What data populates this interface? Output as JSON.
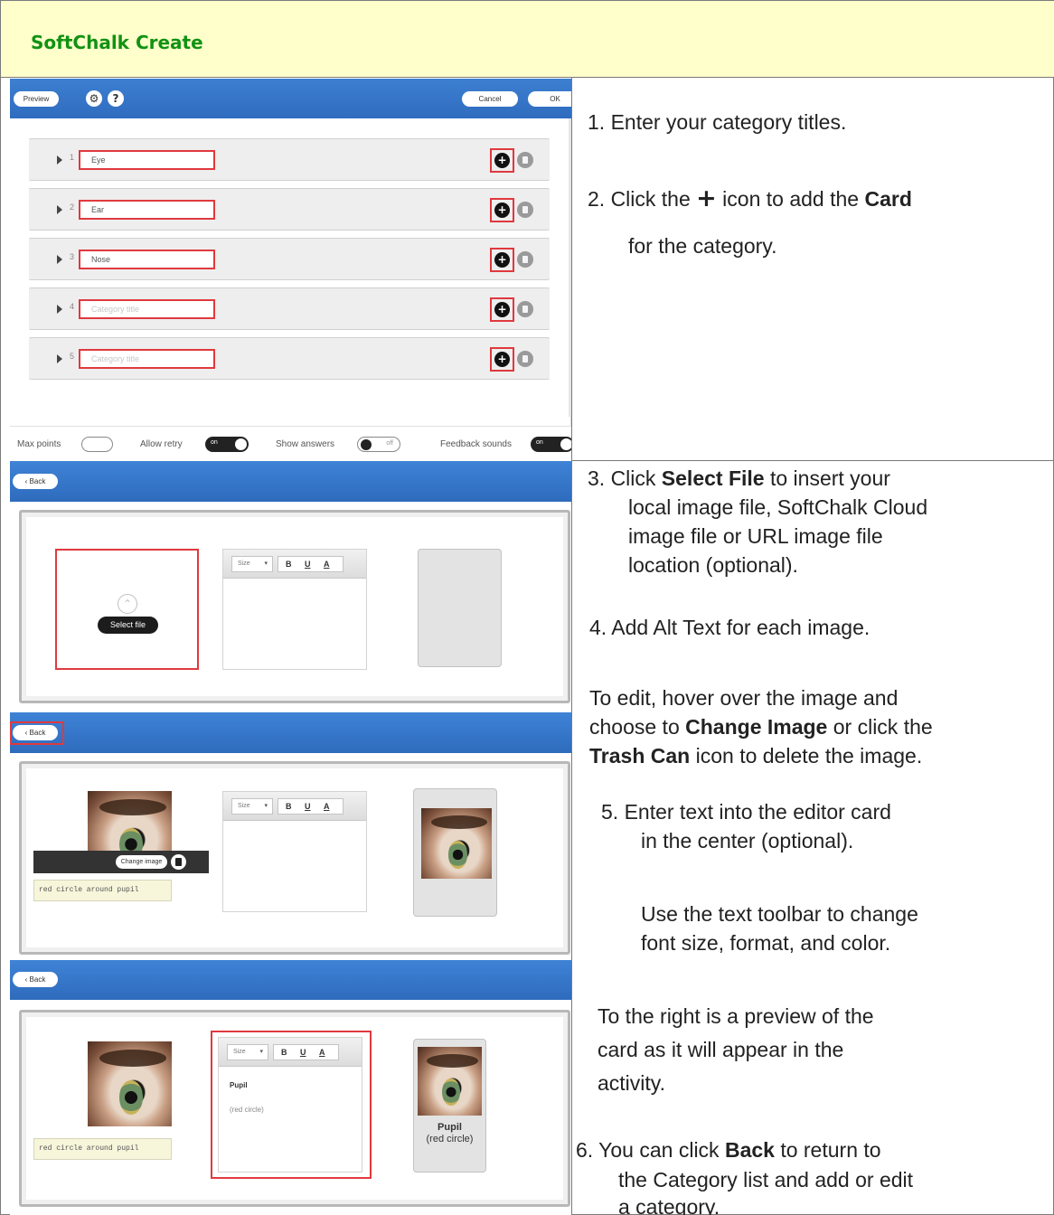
{
  "header": {
    "title": "SoftChalk Create"
  },
  "panel1": {
    "preview_label": "Preview",
    "settings_icon": "gear-icon",
    "help_icon": "question-icon",
    "cancel_label": "Cancel",
    "ok_label": "OK",
    "rows": [
      {
        "num": "1",
        "value": "Eye"
      },
      {
        "num": "2",
        "value": "Ear"
      },
      {
        "num": "3",
        "value": "Nose"
      },
      {
        "num": "4",
        "value": "Category title"
      },
      {
        "num": "5",
        "value": "Category title"
      }
    ],
    "footer": {
      "max_points": "Max points",
      "allow_retry": "Allow retry",
      "allow_retry_state": "on",
      "show_answers": "Show answers",
      "show_answers_state": "off",
      "feedback_sounds": "Feedback sounds",
      "feedback_sounds_state": "on"
    }
  },
  "editor": {
    "back_label": "Back",
    "select_file": "Select file",
    "size_label": "Size",
    "bold": "B",
    "underline": "U",
    "color": "A",
    "change_image": "Change image",
    "alt_text": "red circle around pupil",
    "card_title": "Pupil",
    "card_sub": "(red circle)"
  },
  "instructions": {
    "s1": "1.  Enter your category titles.",
    "s2_pre": "2.  Click the",
    "s2_icon": "+",
    "s2_mid": "icon to add the",
    "s2_bold": "Card",
    "s2_line2": "for the category.",
    "s3_pre": "3.  Click",
    "s3_bold": "Select File",
    "s3_post": "to insert your",
    "s3_l2": "local image file, SoftChalk Cloud",
    "s3_l3": "image file or URL image file",
    "s3_l4": "location (optional).",
    "s4": "4.  Add Alt Text for each image.",
    "edit_l1": "To edit, hover over the image and",
    "edit_l2_pre": "choose to",
    "edit_l2_bold": "Change Image",
    "edit_l2_post": "or click the",
    "edit_l3_bold": "Trash Can",
    "edit_l3_post": "icon to delete the image.",
    "s5_l1": "5.  Enter text into the editor card",
    "s5_l2": "in the center (optional).",
    "tb_l1": "Use the text toolbar to change",
    "tb_l2": "font size, format, and color.",
    "rp_l1": "To the right is a preview of the",
    "rp_l2": "card as it will appear in the",
    "rp_l3": "activity.",
    "s6_pre": "6.  You can click",
    "s6_bold": "Back",
    "s6_post": "to return to",
    "s6_l2": "the Category list and add or edit",
    "s6_l3": "a category."
  }
}
